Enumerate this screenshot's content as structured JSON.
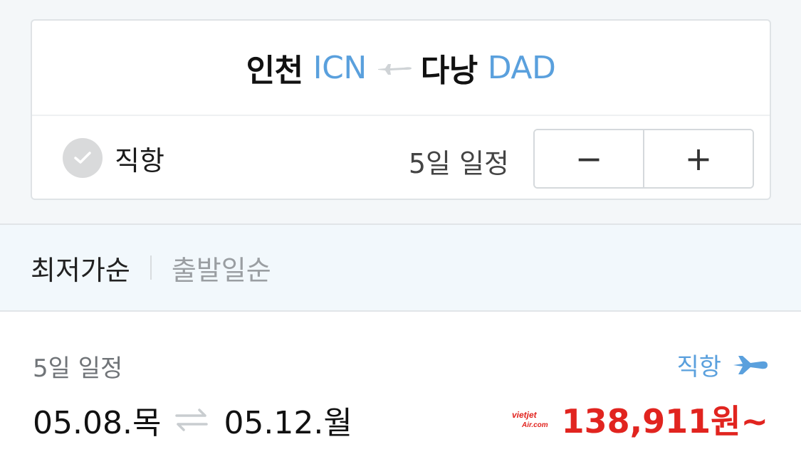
{
  "search": {
    "origin_city": "인천",
    "origin_code": "ICN",
    "dest_city": "다낭",
    "dest_code": "DAD",
    "direct_label": "직항",
    "direct_checked": false,
    "days_label": "5일 일정",
    "minus_label": "−",
    "plus_label": "+"
  },
  "sort": {
    "tabs": [
      {
        "label": "최저가순",
        "active": true
      },
      {
        "label": "출발일순",
        "active": false
      }
    ]
  },
  "result": {
    "days": "5일 일정",
    "direct": "직항",
    "depart": "05.08.목",
    "return": "05.12.월",
    "airline_logo_text_top": "vietjet",
    "airline_logo_text_bottom": "Air.com",
    "price": "138,911원~"
  },
  "colors": {
    "accent": "#5aa0dd",
    "price": "#e1241f",
    "check_off": "#d9dadb"
  }
}
